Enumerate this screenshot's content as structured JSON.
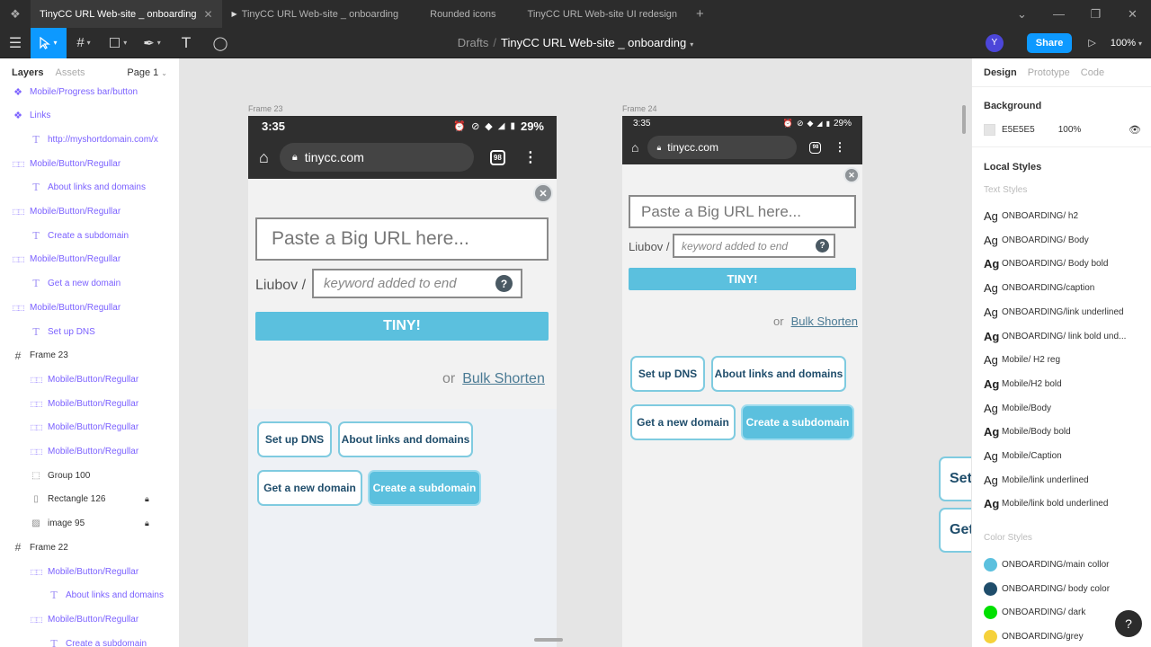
{
  "tabs": [
    {
      "label": "TinyCC URL Web-site _ onboarding",
      "active": true
    },
    {
      "label": "TinyCC URL Web-site _ onboarding",
      "prototype": true
    },
    {
      "label": "Rounded icons"
    },
    {
      "label": "TinyCC URL Web-site UI redesign"
    }
  ],
  "toolbar": {
    "breadcrumb": "Drafts",
    "separator": "/",
    "file_name": "TinyCC URL Web-site _ onboarding",
    "avatar_initial": "Y",
    "share_label": "Share",
    "zoom": "100%"
  },
  "left_panel": {
    "tab_layers": "Layers",
    "tab_assets": "Assets",
    "page": "Page 1",
    "layers": [
      {
        "label": "Mobile/Progress bar/button",
        "kind": "component",
        "indent": 0
      },
      {
        "label": "Links",
        "kind": "component",
        "indent": 0
      },
      {
        "label": "http://myshortdomain.com/x",
        "kind": "text",
        "indent": 1
      },
      {
        "label": "Mobile/Button/Regullar",
        "kind": "instance",
        "indent": 0
      },
      {
        "label": "About links and domains",
        "kind": "text",
        "indent": 1
      },
      {
        "label": "Mobile/Button/Regullar",
        "kind": "instance",
        "indent": 0
      },
      {
        "label": "Create a subdomain",
        "kind": "text",
        "indent": 1
      },
      {
        "label": "Mobile/Button/Regullar",
        "kind": "instance",
        "indent": 0
      },
      {
        "label": "Get a new domain",
        "kind": "text",
        "indent": 1
      },
      {
        "label": "Mobile/Button/Regullar",
        "kind": "instance",
        "indent": 0
      },
      {
        "label": "Set up DNS",
        "kind": "text",
        "indent": 1
      },
      {
        "label": "Frame 23",
        "kind": "frame",
        "indent": 0
      },
      {
        "label": "Mobile/Button/Regullar",
        "kind": "instance",
        "indent": 1
      },
      {
        "label": "Mobile/Button/Regullar",
        "kind": "instance",
        "indent": 1
      },
      {
        "label": "Mobile/Button/Regullar",
        "kind": "instance",
        "indent": 1
      },
      {
        "label": "Mobile/Button/Regullar",
        "kind": "instance",
        "indent": 1
      },
      {
        "label": "Group 100",
        "kind": "group",
        "indent": 1
      },
      {
        "label": "Rectangle 126",
        "kind": "rect",
        "indent": 1,
        "locked": true
      },
      {
        "label": "image 95",
        "kind": "image",
        "indent": 1,
        "locked": true
      },
      {
        "label": "Frame 22",
        "kind": "frame",
        "indent": 0
      },
      {
        "label": "Mobile/Button/Regullar",
        "kind": "instance",
        "indent": 1
      },
      {
        "label": "About links and domains",
        "kind": "text",
        "indent": 2
      },
      {
        "label": "Mobile/Button/Regullar",
        "kind": "instance",
        "indent": 1
      },
      {
        "label": "Create a subdomain",
        "kind": "text",
        "indent": 2
      }
    ]
  },
  "canvas": {
    "frames": [
      {
        "label": "Frame 23",
        "time": "3:35",
        "battery": "29%",
        "url": "tinycc.com",
        "tab_count": "98",
        "input_placeholder": "Paste a Big URL here...",
        "prefix": "Liubov /",
        "keyword_placeholder": "keyword added to end",
        "tiny_label": "TINY!",
        "or_label": "or",
        "bulk_label": "Bulk Shorten",
        "buttons": [
          "Set up DNS",
          "About links and domains",
          "Get a new domain",
          "Create a subdomain"
        ]
      },
      {
        "label": "Frame 24",
        "time": "3:35",
        "battery": "29%",
        "url": "tinycc.com",
        "tab_count": "98",
        "input_placeholder": "Paste a Big URL here...",
        "prefix": "Liubov /",
        "keyword_placeholder": "keyword added to end",
        "tiny_label": "TINY!",
        "or_label": "or",
        "bulk_label": "Bulk Shorten",
        "buttons": [
          "Set up DNS",
          "About links and domains",
          "Get a new domain",
          "Create a subdomain"
        ]
      }
    ],
    "edge_buttons": [
      "Set",
      "Get"
    ]
  },
  "right_panel": {
    "tabs": [
      "Design",
      "Prototype",
      "Code"
    ],
    "background_title": "Background",
    "background_hex": "E5E5E5",
    "background_opacity": "100%",
    "local_styles_title": "Local Styles",
    "text_styles_title": "Text Styles",
    "text_styles": [
      {
        "label": "ONBOARDING/ h2",
        "bold": false
      },
      {
        "label": "ONBOARDING/ Body",
        "bold": false
      },
      {
        "label": "ONBOARDING/ Body bold",
        "bold": true
      },
      {
        "label": "ONBOARDING/caption",
        "bold": false
      },
      {
        "label": "ONBOARDING/link underlined",
        "bold": false
      },
      {
        "label": "ONBOARDING/ link bold und...",
        "bold": true
      },
      {
        "label": "Mobile/ H2 reg",
        "bold": false
      },
      {
        "label": "Mobile/H2 bold",
        "bold": true
      },
      {
        "label": "Mobile/Body",
        "bold": false
      },
      {
        "label": "Mobile/Body bold",
        "bold": true
      },
      {
        "label": "Mobile/Caption",
        "bold": false
      },
      {
        "label": "Mobile/link underlined",
        "bold": false
      },
      {
        "label": "Mobile/link bold underlined",
        "bold": true
      }
    ],
    "color_styles_title": "Color Styles",
    "color_styles": [
      {
        "label": "ONBOARDING/main collor",
        "color": "#5bc0de"
      },
      {
        "label": "ONBOARDING/ body color",
        "color": "#1f4d6b"
      },
      {
        "label": "ONBOARDING/ dark",
        "color": "#00e000"
      },
      {
        "label": "ONBOARDING/grey",
        "color": "#f5d13b"
      }
    ]
  },
  "help_label": "?"
}
